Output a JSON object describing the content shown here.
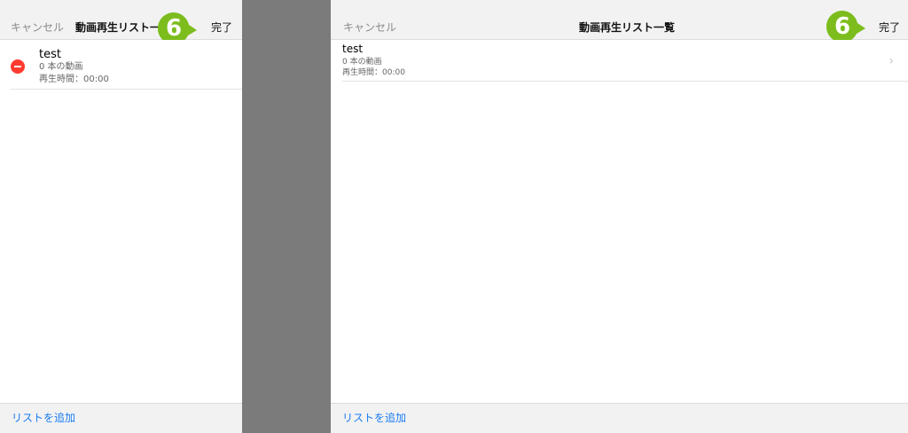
{
  "colors": {
    "divider_gray": "#7b7b7b",
    "accent_blue": "#1a7cf2",
    "badge_green": "#7cbd1d",
    "delete_red": "#ff3b30"
  },
  "left_panel": {
    "nav": {
      "cancel": "キャンセル",
      "title": "動画再生リスト一",
      "done": "完了"
    },
    "badge": "6",
    "item": {
      "title": "test",
      "count": "0 本の動画",
      "duration": "再生時間：00:00"
    },
    "toolbar": {
      "add": "リストを追加"
    }
  },
  "right_panel": {
    "nav": {
      "cancel": "キャンセル",
      "title": "動画再生リスト一覧",
      "done": "完了"
    },
    "badge": "6",
    "item": {
      "title": "test",
      "count": "0 本の動画",
      "duration": "再生時間：00:00"
    },
    "toolbar": {
      "add": "リストを追加"
    }
  },
  "icons": {
    "delete": "minus-circle-icon",
    "chevron": "chevron-right-icon"
  }
}
